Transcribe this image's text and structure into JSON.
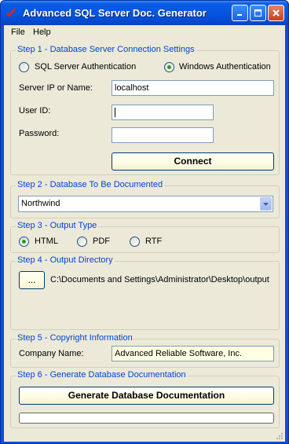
{
  "window": {
    "title": "Advanced SQL Server Doc. Generator",
    "icon": "check-mark-icon",
    "controls": [
      "minimize-icon",
      "maximize-icon",
      "close-icon"
    ]
  },
  "menu": {
    "file": "File",
    "help": "Help"
  },
  "step1": {
    "legend": "Step 1 - Database Server Connection Settings",
    "auth_sql": "SQL Server Authentication",
    "auth_windows": "Windows Authentication",
    "selected_auth": "windows",
    "server_label": "Server IP or Name:",
    "server_value": "localhost",
    "user_label": "User ID:",
    "user_value": "",
    "password_label": "Password:",
    "password_value": "",
    "connect_label": "Connect"
  },
  "step2": {
    "legend": "Step 2 - Database To Be Documented",
    "selected_database": "Northwind"
  },
  "step3": {
    "legend": "Step 3 - Output Type",
    "opt_html": "HTML",
    "opt_pdf": "PDF",
    "opt_rtf": "RTF",
    "selected": "html"
  },
  "step4": {
    "legend": "Step 4 - Output Directory",
    "browse_label": "...",
    "path": "C:\\Documents and Settings\\Administrator\\Desktop\\output"
  },
  "step5": {
    "legend": "Step 5 - Copyright Information",
    "company_label": "Company Name:",
    "company_value": "Advanced Reliable Software, Inc."
  },
  "step6": {
    "legend": "Step 6 - Generate Database Documentation",
    "generate_label": "Generate Database Documentation",
    "progress": 0
  },
  "colors": {
    "title_bar": "#0456e0",
    "client_bg": "#ece9d8",
    "legend_text": "#0046d5",
    "readonly_field": "#ffffe1",
    "button_face": "#fefce4",
    "radio_dot": "#21a121"
  }
}
